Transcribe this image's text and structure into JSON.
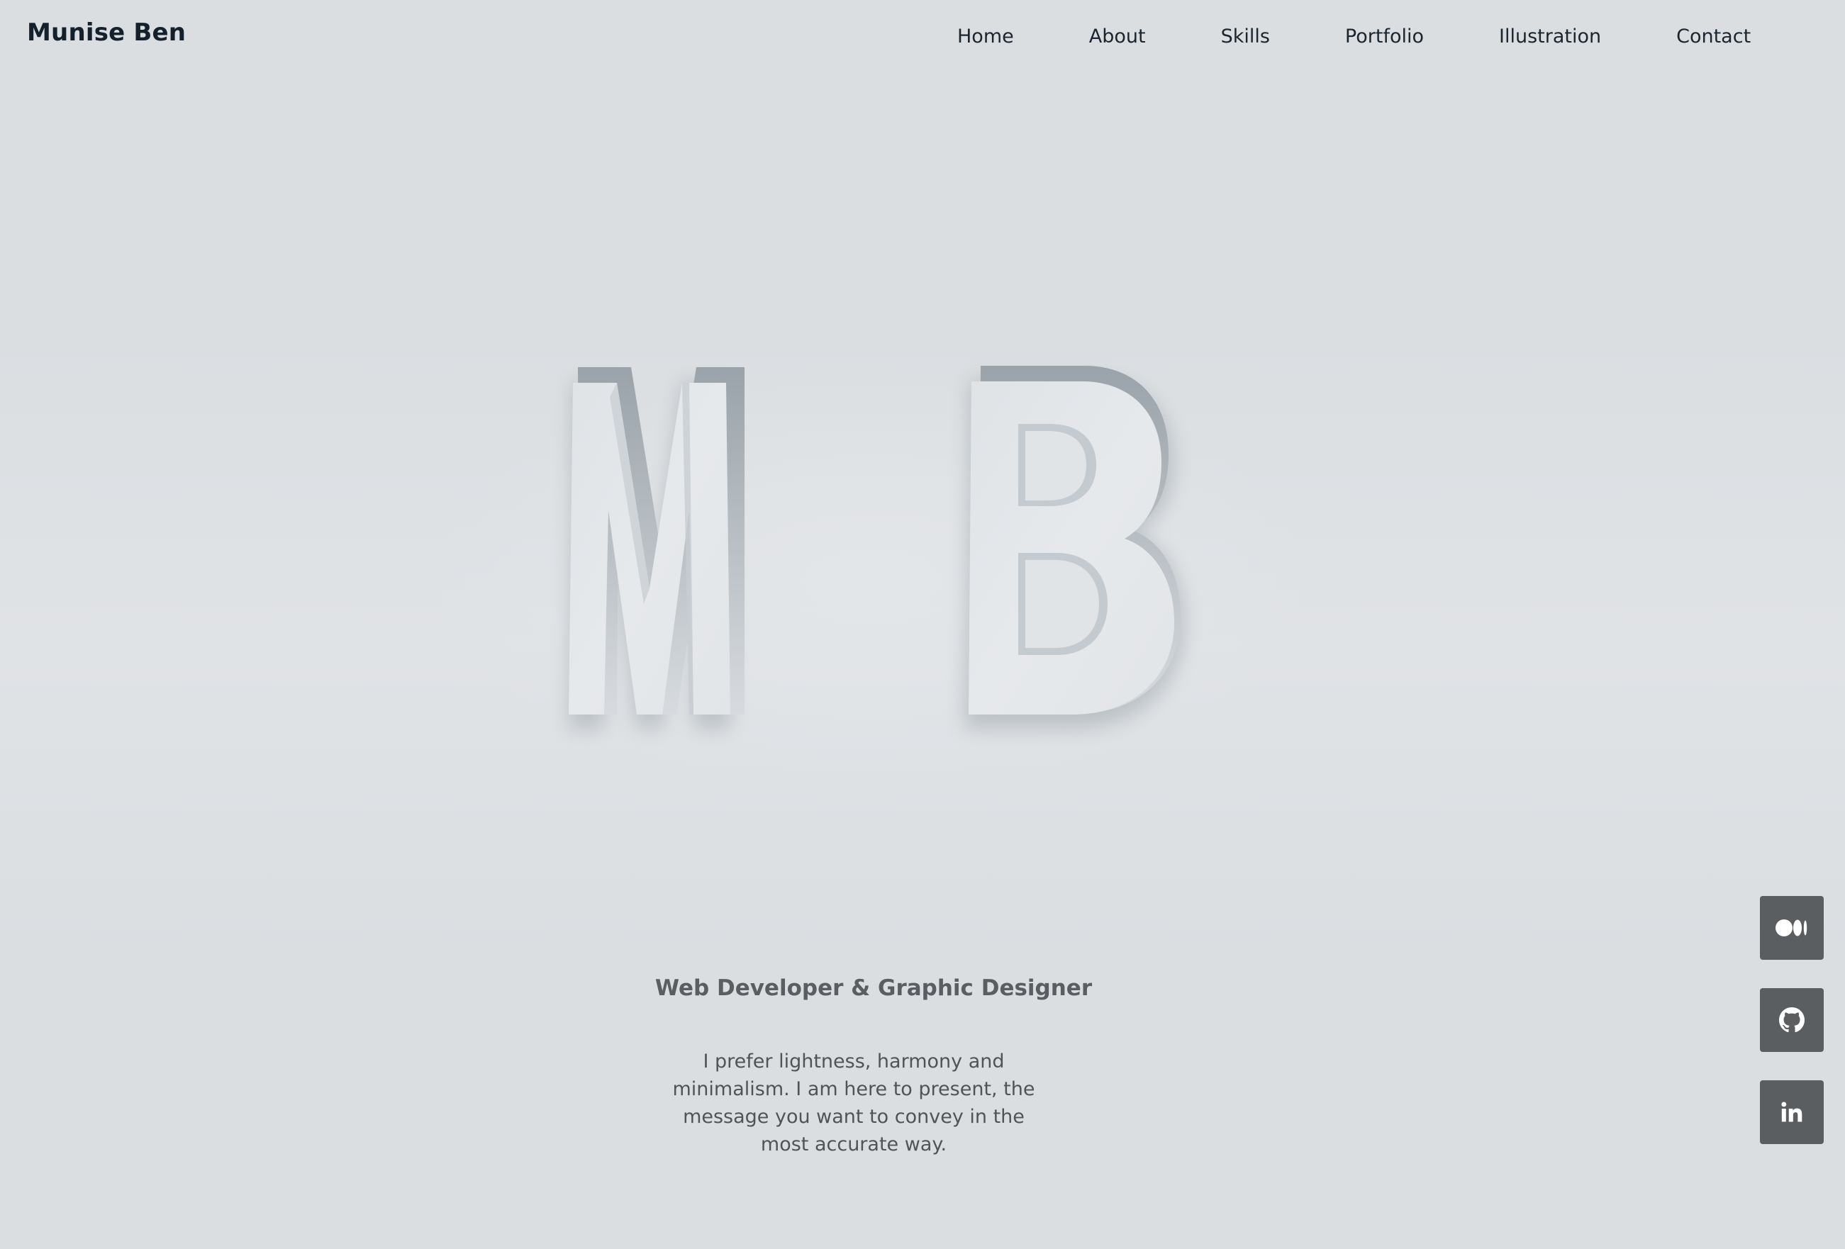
{
  "header": {
    "brand": "Munise Ben",
    "nav": [
      {
        "label": "Home"
      },
      {
        "label": "About"
      },
      {
        "label": "Skills"
      },
      {
        "label": "Portfolio"
      },
      {
        "label": "Illustration"
      },
      {
        "label": "Contact"
      }
    ]
  },
  "hero": {
    "monogram": [
      "M",
      "B"
    ]
  },
  "main": {
    "subtitle": "Web Developer & Graphic Designer",
    "intro": "I prefer lightness, harmony and minimalism. I am here to present, the message you want to convey in the most accurate way."
  },
  "social": [
    {
      "icon": "medium-icon"
    },
    {
      "icon": "github-icon"
    },
    {
      "icon": "linkedin-icon"
    }
  ],
  "colors": {
    "background": "#dadee1",
    "text_dark": "#14202b",
    "text_muted": "#5a5e62",
    "social_button": "#5b5e61"
  }
}
